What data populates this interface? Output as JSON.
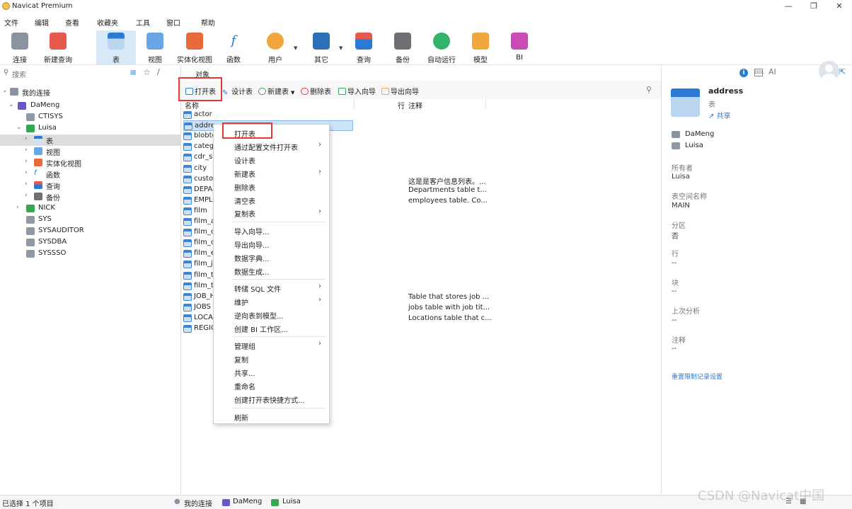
{
  "window": {
    "title": "Navicat Premium"
  },
  "menubar": [
    "文件",
    "编辑",
    "查看",
    "收藏夹",
    "工具",
    "窗口",
    "帮助"
  ],
  "toolbar": {
    "buttons": [
      "连接",
      "新建查询",
      "表",
      "视图",
      "实体化视图",
      "函数",
      "用户",
      "其它",
      "查询",
      "备份",
      "自动运行",
      "模型",
      "BI"
    ]
  },
  "left": {
    "search_placeholder": "搜索",
    "tree": {
      "root": "我的连接",
      "conn": "DaMeng",
      "schemas": [
        "CTISYS",
        "Luisa",
        "NICK",
        "SYS",
        "SYSAUDITOR",
        "SYSDBA",
        "SYSSSO"
      ],
      "luisa_children": [
        "表",
        "视图",
        "实体化视图",
        "函数",
        "查询",
        "备份"
      ]
    }
  },
  "center": {
    "tab": "对象",
    "actions": [
      "打开表",
      "设计表",
      "新建表",
      "删除表",
      "导入向导",
      "导出向导"
    ],
    "columns": {
      "name": "名称",
      "rows": "行",
      "comment": "注释"
    },
    "tables": [
      "actor",
      "addre",
      "blobte",
      "catego",
      "cdr_sk",
      "city",
      "custor",
      "DEPAI",
      "EMPLO",
      "film",
      "film_a",
      "film_c",
      "film_c",
      "film_e",
      "film_js",
      "film_te",
      "film_te",
      "JOB_H",
      "JOBS",
      "LOCA",
      "REGIO"
    ],
    "comments": [
      {
        "row": 6,
        "text": "这是是客户信息列表。..."
      },
      {
        "row": 7,
        "text": "Departments table t..."
      },
      {
        "row": 8,
        "text": "employees table. Co..."
      },
      {
        "row": 17,
        "text": "Table that stores job ..."
      },
      {
        "row": 18,
        "text": "jobs table with job tit..."
      },
      {
        "row": 19,
        "text": "Locations table that c..."
      }
    ]
  },
  "context_menu": {
    "items": [
      {
        "label": "打开表"
      },
      {
        "label": "通过配置文件打开表",
        "sub": true
      },
      {
        "label": "设计表"
      },
      {
        "label": "新建表",
        "sub": true
      },
      {
        "label": "删除表"
      },
      {
        "label": "清空表"
      },
      {
        "label": "复制表",
        "sub": true
      },
      {
        "label": "导入向导..."
      },
      {
        "label": "导出向导..."
      },
      {
        "label": "数据字典..."
      },
      {
        "label": "数据生成..."
      },
      {
        "label": "转储 SQL 文件",
        "sub": true
      },
      {
        "label": "维护",
        "sub": true
      },
      {
        "label": "逆向表到模型..."
      },
      {
        "label": "创建 BI 工作区..."
      },
      {
        "label": "管理组",
        "sub": true
      },
      {
        "label": "复制"
      },
      {
        "label": "共享..."
      },
      {
        "label": "重命名"
      },
      {
        "label": "创建打开表快捷方式..."
      },
      {
        "label": "刷新"
      }
    ]
  },
  "right": {
    "name": "address",
    "type": "表",
    "share": "共享",
    "conn": "DaMeng",
    "schema": "Luisa",
    "fields": [
      {
        "label": "所有者",
        "value": "Luisa"
      },
      {
        "label": "表空间名称",
        "value": "MAIN"
      },
      {
        "label": "分区",
        "value": "否"
      },
      {
        "label": "行",
        "value": "--"
      },
      {
        "label": "块",
        "value": "--"
      },
      {
        "label": "上次分析",
        "value": "--"
      },
      {
        "label": "注释",
        "value": "--"
      }
    ],
    "reset_link": "重置限制记录设置"
  },
  "status": {
    "selected": "已选择 1 个项目",
    "crumbs": [
      "我的连接",
      "DaMeng",
      "Luisa"
    ]
  },
  "watermark": "CSDN @Navicat中国",
  "colors": {
    "accent": "#2a7ad5",
    "highlight": "#e53935"
  }
}
